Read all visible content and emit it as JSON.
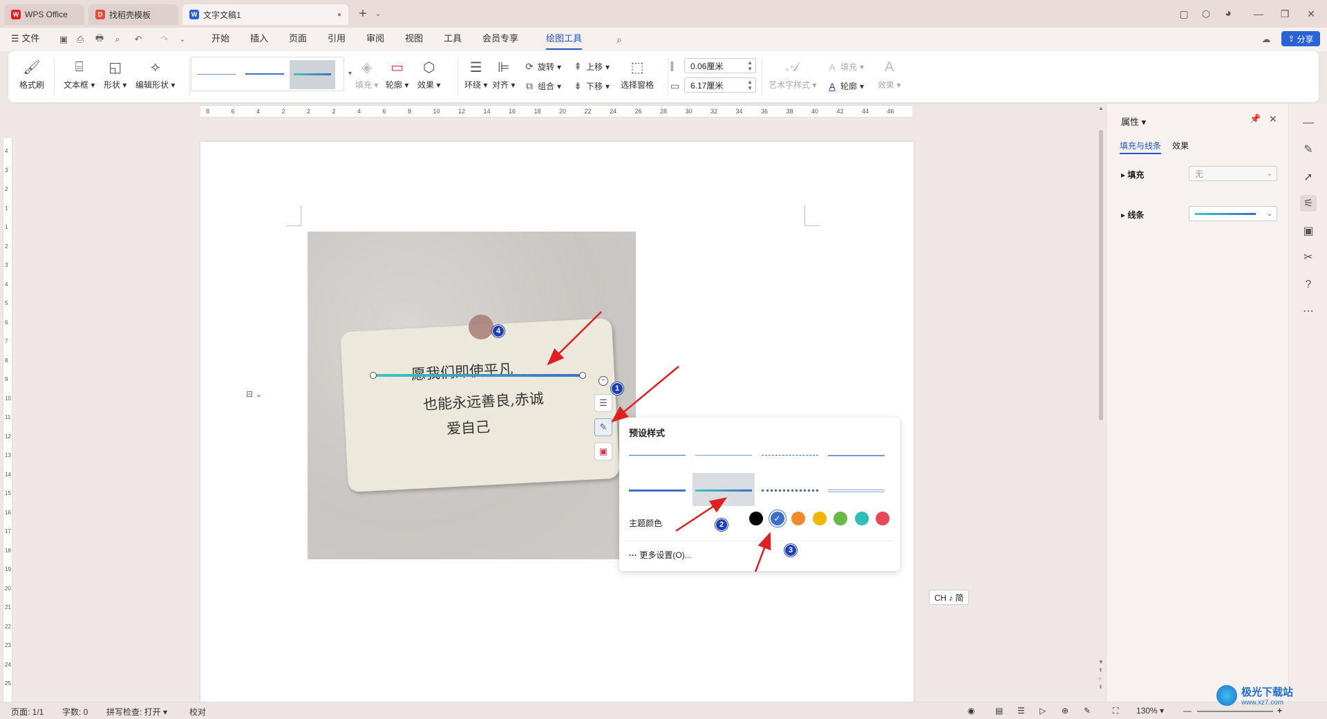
{
  "tabs": [
    {
      "label": "WPS Office",
      "icon": "wps-logo-icon"
    },
    {
      "label": "找稻壳模板",
      "icon": "docer-icon"
    },
    {
      "label": "文字文稿1",
      "icon": "word-doc-icon"
    }
  ],
  "menu": {
    "file": "文件",
    "items": [
      "开始",
      "插入",
      "页面",
      "引用",
      "审阅",
      "视图",
      "工具",
      "会员专享",
      "绘图工具"
    ],
    "active": "绘图工具",
    "share": "分享"
  },
  "ribbon": {
    "format_painter": "格式刷",
    "textbox": "文本框",
    "shape": "形状",
    "edit_shape": "编辑形状",
    "fill": "填充",
    "outline": "轮廓",
    "effect": "效果",
    "wrap": "环绕",
    "align": "对齐",
    "rotate": "旋转",
    "group": "组合",
    "bring_forward": "上移",
    "send_backward": "下移",
    "selection_pane": "选择窗格",
    "height_value": "0.06厘米",
    "width_value": "6.17厘米",
    "art_style": "艺术字样式",
    "text_fill": "填充",
    "text_outline": "轮廓",
    "text_effect": "效果"
  },
  "ruler": {
    "h_ticks": [
      "8",
      "6",
      "4",
      "2",
      "2",
      "2",
      "4",
      "6",
      "8",
      "10",
      "12",
      "14",
      "16",
      "18",
      "20",
      "22",
      "24",
      "26",
      "28",
      "30",
      "32",
      "34",
      "36",
      "38",
      "40",
      "42",
      "44",
      "46"
    ],
    "v_ticks": [
      "4",
      "3",
      "2",
      "1",
      "1",
      "2",
      "3",
      "4",
      "5",
      "6",
      "7",
      "8",
      "9",
      "10",
      "11",
      "12",
      "13",
      "14",
      "15",
      "16",
      "17",
      "18",
      "19",
      "20",
      "21",
      "22",
      "23",
      "24",
      "25"
    ]
  },
  "document": {
    "handwriting": [
      "愿我们即使平凡",
      "也能永远善良,赤诚",
      "爱自己"
    ]
  },
  "popup": {
    "title": "预设样式",
    "theme_colors_label": "主题颜色",
    "more_settings": "更多设置(O)...",
    "theme_colors": [
      "#000000",
      "#3d6ec9",
      "#f08a2c",
      "#f1b700",
      "#6bb84a",
      "#2fbfb6",
      "#e84855"
    ],
    "selected_color": "#3d6ec9"
  },
  "badges": [
    "1",
    "2",
    "3",
    "4"
  ],
  "ime": "CH ♪ 简",
  "right_panel": {
    "title": "属性",
    "tab_fill_line": "填充与线条",
    "tab_effect": "效果",
    "fill_label": "填充",
    "fill_value": "无",
    "line_label": "线条"
  },
  "status": {
    "page": "页面: 1/1",
    "words": "字数: 0",
    "spell": "拼写检查: 打开",
    "proof": "校对",
    "zoom": "130%"
  },
  "watermark": "极光下载站",
  "watermark_url": "www.xz7.com"
}
